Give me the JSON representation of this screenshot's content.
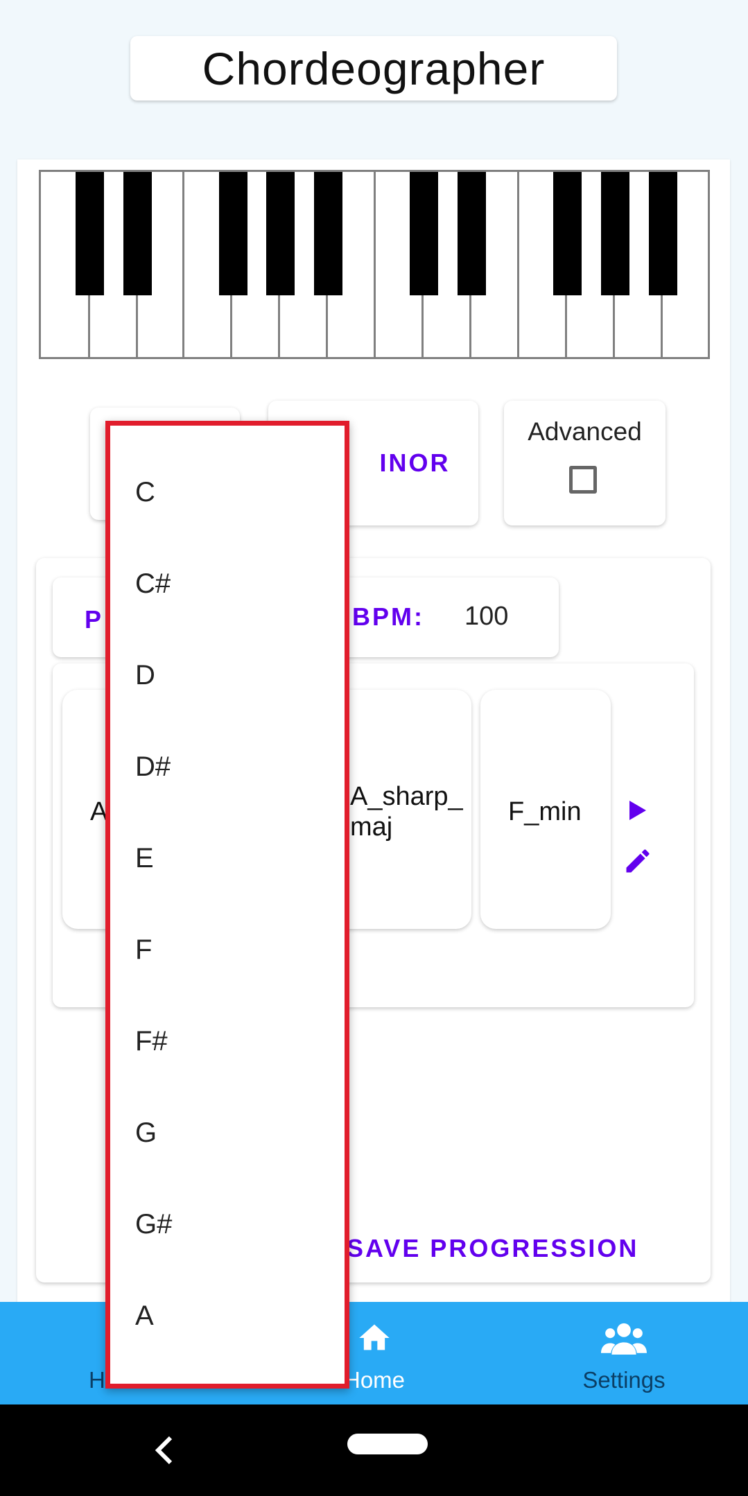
{
  "app": {
    "title": "Chordeographer"
  },
  "controls": {
    "mode_label": "INOR",
    "advanced_label": "Advanced",
    "play_label": "P",
    "bpm_label": "BPM:",
    "bpm_value": "100"
  },
  "chords": [
    {
      "label": "A"
    },
    {
      "label": "A_sharp_\nmaj"
    },
    {
      "label": "F_min"
    }
  ],
  "actions": {
    "save_label": "SAVE PROGRESSION"
  },
  "nav": {
    "left_label": "H",
    "home_label": "Home",
    "settings_label": "Settings"
  },
  "dropdown": {
    "options": [
      "C",
      "C#",
      "D",
      "D#",
      "E",
      "F",
      "F#",
      "G",
      "G#",
      "A"
    ]
  },
  "colors": {
    "accent": "#6200ee",
    "nav_bg": "#29aaf5",
    "highlight_border": "#e11d2c"
  },
  "icons": {
    "play": "play-icon",
    "edit": "pencil-icon",
    "home": "house-icon",
    "settings": "people-group-icon",
    "back": "chevron-left-icon"
  }
}
